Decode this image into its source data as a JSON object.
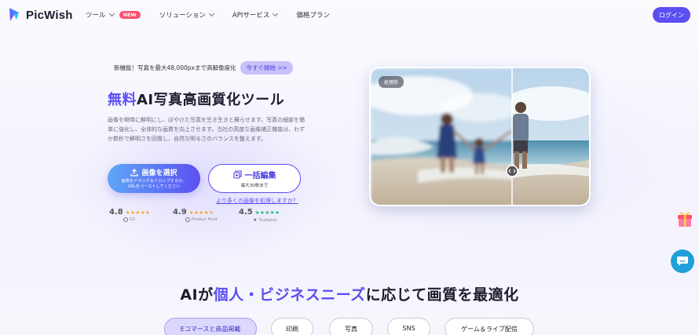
{
  "header": {
    "brand": "PicWish",
    "nav": [
      {
        "label": "ツール",
        "badge": "NEW"
      },
      {
        "label": "ソリューション"
      },
      {
        "label": "APIサービス"
      },
      {
        "label": "価格プラン"
      }
    ],
    "login_label": "ログイン"
  },
  "hero": {
    "promo_text": "新機能！写真を最大48,000pxまで高解像度化",
    "promo_button": "今すぐ開始 >>",
    "title_accent": "無料",
    "title_rest": "AI写真高画質化ツール",
    "description": "画像を瞬時に鮮明にし、ぼやけた写真を生き生きと蘇らせます。写真の細部を簡単に強化し、全体的な画質を向上させます。当社の高度な画像補正機能は、わずか数秒で鮮明さを回復し、自然な明るさのバランスを整えます。",
    "upload_label": "画像を選択",
    "upload_sub_line1": "画像をドラッグ＆ドロップするか、",
    "upload_sub_line2": "URLをペーストしてください",
    "batch_label": "一括編集",
    "batch_sub": "最大30枚まで",
    "more_link": "より多くの画像を処理しますか？",
    "before_tag": "処理前"
  },
  "ratings": [
    {
      "score": "4.8",
      "stars": "★★★★★",
      "source": "G2",
      "color": "#f5a623"
    },
    {
      "score": "4.9",
      "stars": "★★★★★",
      "source": "Product Hunt",
      "color": "#f5a623"
    },
    {
      "score": "4.5",
      "stars": "★★★★★",
      "source": "Trustpilot",
      "color": "#16b879"
    }
  ],
  "section": {
    "title_pre": "AIが",
    "title_accent": "個人・ビジネスニーズ",
    "title_post": "に応じて画質を最適化",
    "tabs": [
      "Eコマースと商品掲載",
      "印刷",
      "写真",
      "SNS",
      "ゲーム＆ライブ配信"
    ]
  },
  "colors": {
    "accent": "#5b4ff2",
    "badge": "#ff4d6d",
    "chat": "#1fa0d8"
  }
}
